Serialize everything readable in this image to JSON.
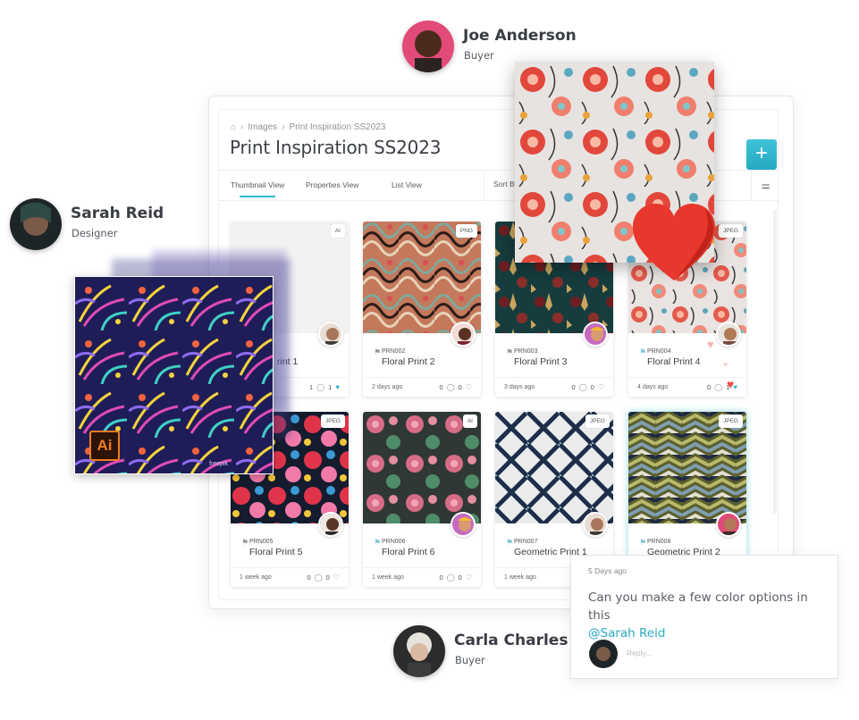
{
  "users": {
    "joe": {
      "name": "Joe Anderson",
      "role": "Buyer"
    },
    "sarah": {
      "name": "Sarah Reid",
      "role": "Designer"
    },
    "carla": {
      "name": "Carla Charles",
      "role": "Buyer"
    }
  },
  "breadcrumb": {
    "home_icon": "home-icon",
    "items": [
      "Images",
      "Print Inspiration SS2023"
    ]
  },
  "page_title": "Print Inspiration SS2023",
  "add_button": {
    "label": "+"
  },
  "tabs": [
    {
      "label": "Thumbnail View",
      "active": true
    },
    {
      "label": "Properties View",
      "active": false
    },
    {
      "label": "List View",
      "active": false
    }
  ],
  "sort_label": "Sort By",
  "accent_color": "#2fb5cc",
  "tiles": [
    {
      "badge": "AI",
      "code": "",
      "name": "Floral Print 1",
      "name_visible": "rint 1",
      "date": "",
      "comments": "1",
      "likes": "1",
      "liked": true
    },
    {
      "badge": "PNG",
      "code": "PRN002",
      "name": "Floral Print 2",
      "date": "2 days ago",
      "comments": "0",
      "likes": "0",
      "liked": false
    },
    {
      "badge": "",
      "code": "PRN003",
      "name": "Floral Print 3",
      "date": "3 days ago",
      "comments": "0",
      "likes": "0",
      "liked": false
    },
    {
      "badge": "JPEG",
      "code": "PRN004",
      "name": "Floral Print 4",
      "date": "4 days ago",
      "comments": "0",
      "likes": "1",
      "liked": true
    },
    {
      "badge": "JPEG",
      "code": "PRN005",
      "name": "Floral Print 5",
      "date": "1 week ago",
      "comments": "0",
      "likes": "0",
      "liked": false
    },
    {
      "badge": "AI",
      "code": "PRN006",
      "name": "Floral Print 6",
      "date": "1 week ago",
      "comments": "0",
      "likes": "0",
      "liked": false
    },
    {
      "badge": "JPEG",
      "code": "PRN007",
      "name": "Geometric Print 1",
      "date": "1 week ago",
      "comments": "",
      "likes": "",
      "liked": false
    },
    {
      "badge": "JPEG",
      "code": "PRN008",
      "name": "Geometric Print 2",
      "date": "",
      "comments": "",
      "likes": "",
      "liked": false
    }
  ],
  "floating_card": {
    "badge": "Ai",
    "watermark": "freepik"
  },
  "comment": {
    "ago": "5 Days ago",
    "text": "Can you make a few color options in this",
    "mention": "@Sarah Reid",
    "reply_placeholder": "Reply..."
  }
}
